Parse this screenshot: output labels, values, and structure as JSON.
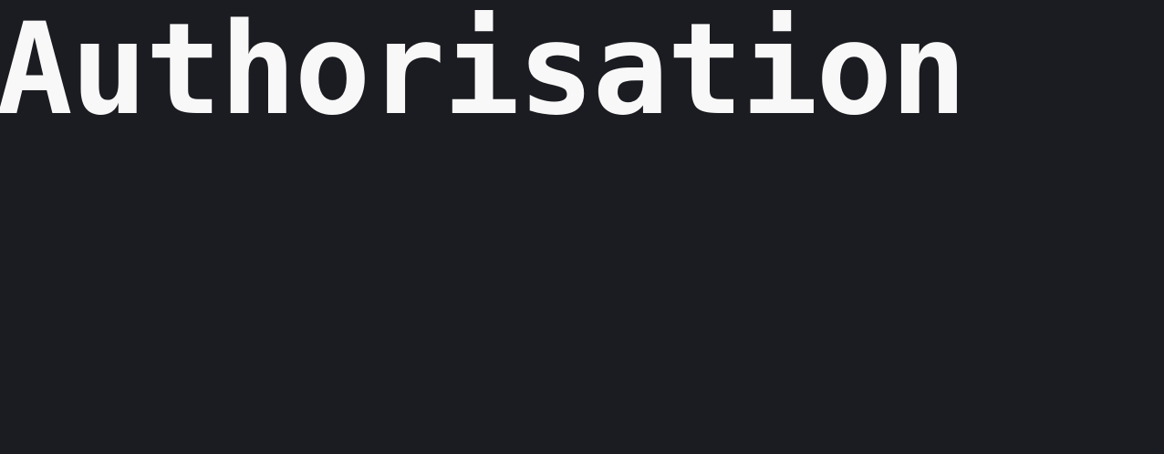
{
  "page": {
    "title": "Authorisation"
  },
  "colors": {
    "background": "#1b1c21",
    "title_text": "#f8f8f8"
  }
}
